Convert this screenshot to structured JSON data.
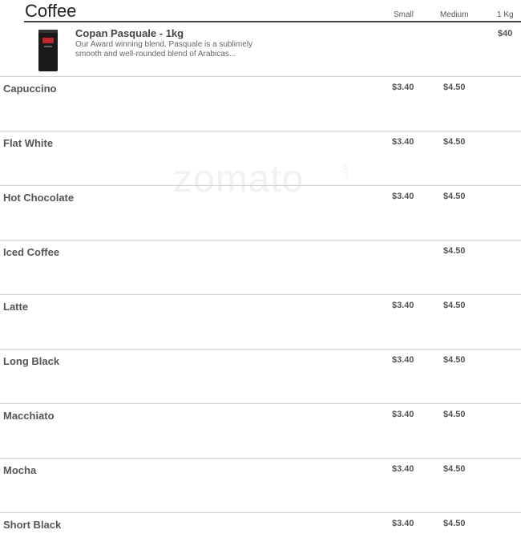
{
  "section": {
    "title": "Coffee",
    "columns": {
      "small": "Small",
      "medium": "Medium",
      "kg": "1 Kg"
    }
  },
  "featured": {
    "name": "Copan Pasquale - 1kg",
    "description": "Our Award winning blend. Pasquale is a sublimely smooth and well-rounded blend of Arabicas...",
    "price_kg": "$40"
  },
  "items": [
    {
      "name": "Capuccino",
      "small": "$3.40",
      "medium": "$4.50"
    },
    {
      "name": "Flat White",
      "small": "$3.40",
      "medium": "$4.50"
    },
    {
      "name": "Hot Chocolate",
      "small": "$3.40",
      "medium": "$4.50"
    },
    {
      "name": "Iced Coffee",
      "small": "",
      "medium": "$4.50"
    },
    {
      "name": "Latte",
      "small": "$3.40",
      "medium": "$4.50"
    },
    {
      "name": "Long Black",
      "small": "$3.40",
      "medium": "$4.50"
    },
    {
      "name": "Macchiato",
      "small": "$3.40",
      "medium": "$4.50"
    },
    {
      "name": "Mocha",
      "small": "$3.40",
      "medium": "$4.50"
    },
    {
      "name": "Short Black",
      "small": "$3.40",
      "medium": "$4.50"
    }
  ],
  "watermark": {
    "text": "zomato",
    "suffix": ".com"
  },
  "colors": {
    "bag": "#1a1a1a",
    "bag_label": "#c0262d"
  }
}
